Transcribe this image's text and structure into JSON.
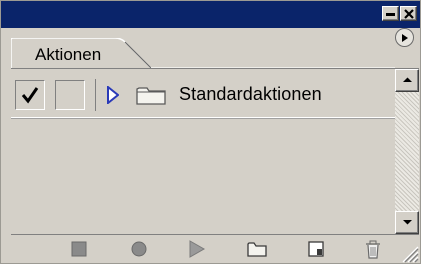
{
  "panel": {
    "tab_label": "Aktionen"
  },
  "titlebar": {
    "icons": [
      "minimize-icon",
      "close-icon"
    ]
  },
  "actions_list": {
    "rows": [
      {
        "checked": true,
        "label": "Standardaktionen",
        "icon": "folder-icon",
        "expand_icon": "expand-triangle-icon"
      }
    ]
  },
  "toolbar": {
    "icons": [
      "stop-icon",
      "record-icon",
      "play-icon",
      "new-set-icon",
      "new-action-icon",
      "trash-icon"
    ]
  },
  "colors": {
    "titlebar": "#0a246a",
    "panel_bg": "#d4d0c8",
    "expand_triangle": "#2a3ab8"
  }
}
